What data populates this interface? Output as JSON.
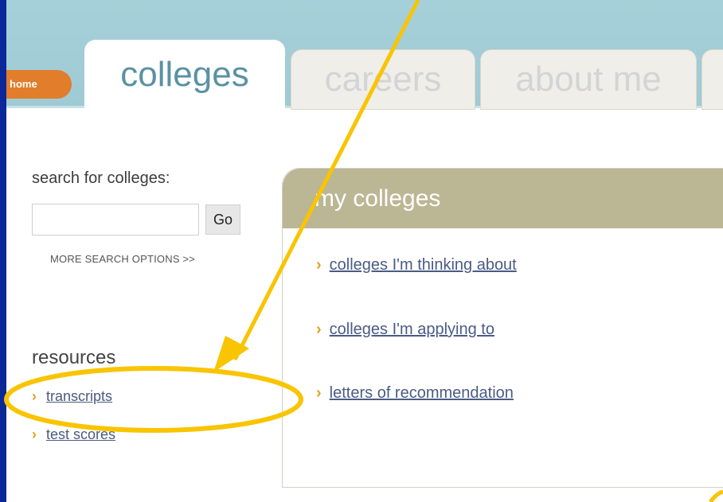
{
  "nav": {
    "home_label": "home",
    "tabs": [
      {
        "label": "colleges",
        "active": true
      },
      {
        "label": "careers",
        "active": false
      },
      {
        "label": "about me",
        "active": false
      }
    ]
  },
  "search": {
    "label": "search for colleges:",
    "input_value": "",
    "go_label": "Go",
    "more_options": "MORE SEARCH OPTIONS >>"
  },
  "resources": {
    "title": "resources",
    "items": [
      {
        "label": "transcripts",
        "icon": "chevron-right-icon"
      },
      {
        "label": "test scores",
        "icon": "chevron-right-icon"
      }
    ]
  },
  "my_colleges": {
    "title": "my colleges",
    "items": [
      {
        "label": "colleges I'm thinking about",
        "icon": "chevron-right-icon"
      },
      {
        "label": "colleges I'm applying to",
        "icon": "chevron-right-icon"
      },
      {
        "label": "letters of recommendation",
        "icon": "chevron-right-icon"
      }
    ]
  },
  "colors": {
    "border_blue": "#0c2898",
    "annotation_yellow": "#f9c400",
    "home_orange": "#e27d2b",
    "header_tan": "#bbb694",
    "chevron": "#e2a11d"
  }
}
